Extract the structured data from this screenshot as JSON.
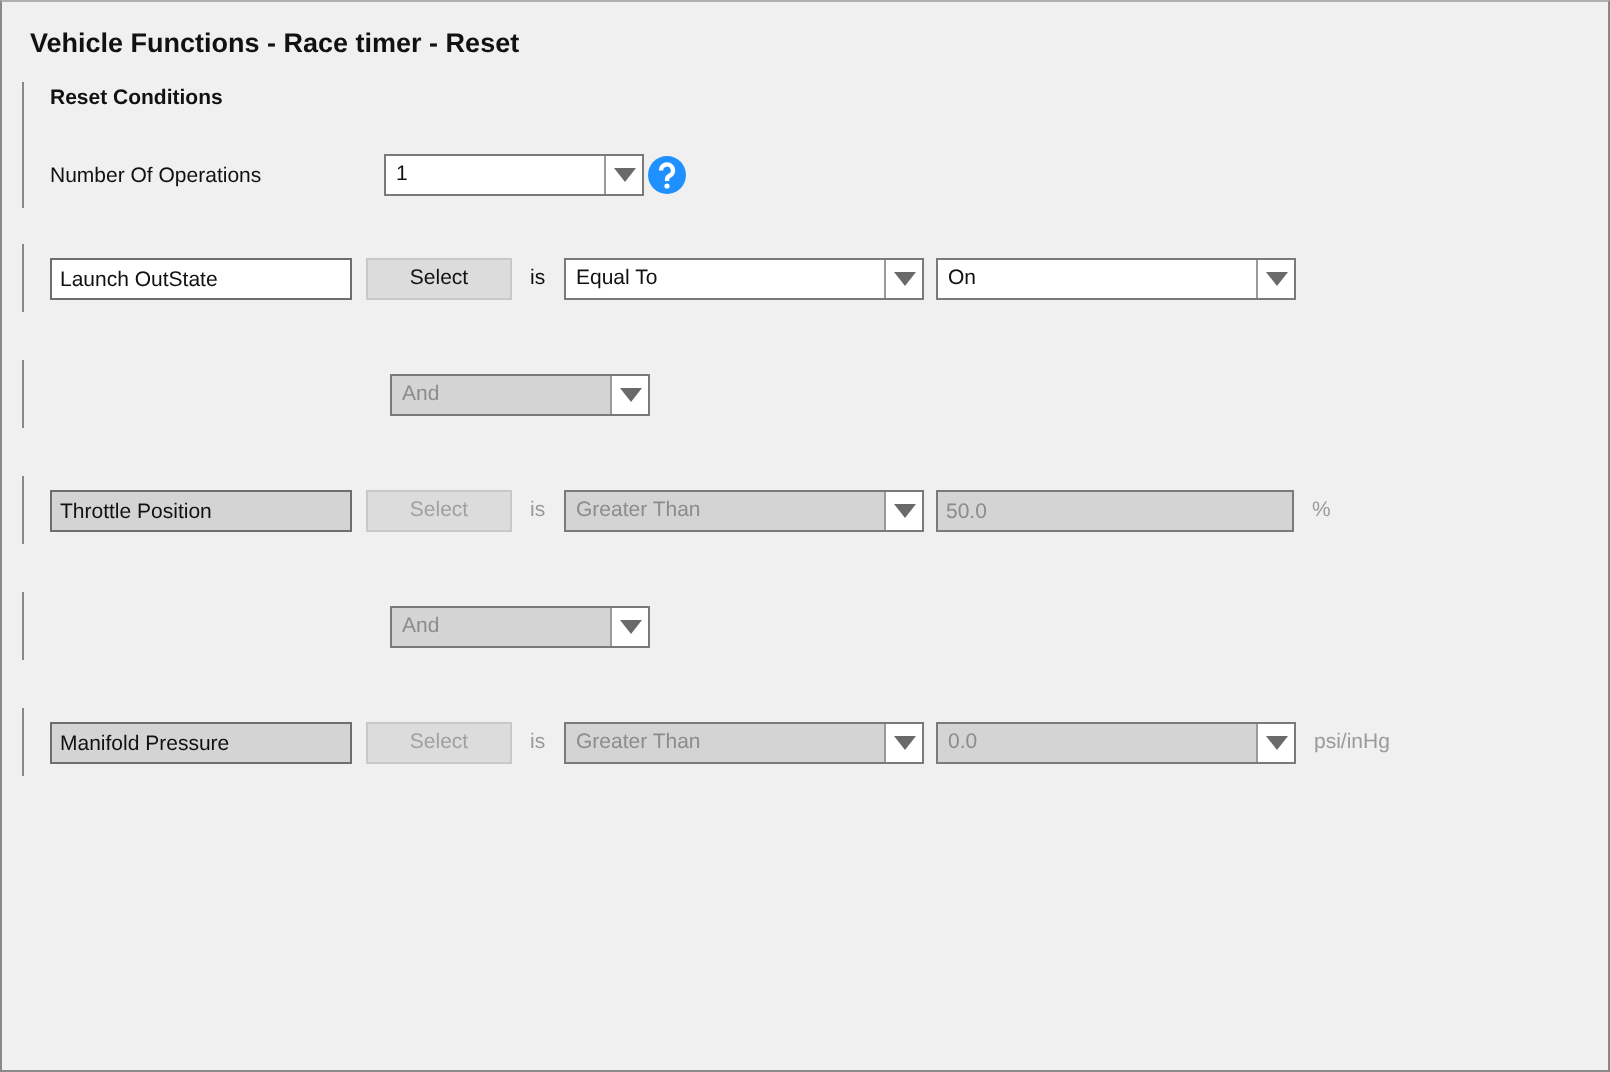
{
  "window": {
    "title": "Vehicle Functions - Race timer - Reset"
  },
  "section": {
    "title": "Reset Conditions",
    "operations_label": "Number Of Operations",
    "operations_value": "1"
  },
  "rows": [
    {
      "kind": "condition",
      "disabled": false,
      "signal": "Launch OutState",
      "select": "Select",
      "is": "is",
      "operator": "Equal To",
      "value": {
        "kind": "dropdown",
        "text": "On"
      },
      "unit": ""
    },
    {
      "kind": "connector",
      "disabled": true,
      "value": "And"
    },
    {
      "kind": "condition",
      "disabled": true,
      "signal": "Throttle Position",
      "select": "Select",
      "is": "is",
      "operator": "Greater Than",
      "value": {
        "kind": "text",
        "text": "50.0"
      },
      "unit": "%"
    },
    {
      "kind": "connector",
      "disabled": true,
      "value": "And"
    },
    {
      "kind": "condition",
      "disabled": true,
      "signal": "Manifold Pressure",
      "select": "Select",
      "is": "is",
      "operator": "Greater Than",
      "value": {
        "kind": "dropdown",
        "text": "0.0"
      },
      "unit": "psi/inHg"
    }
  ]
}
